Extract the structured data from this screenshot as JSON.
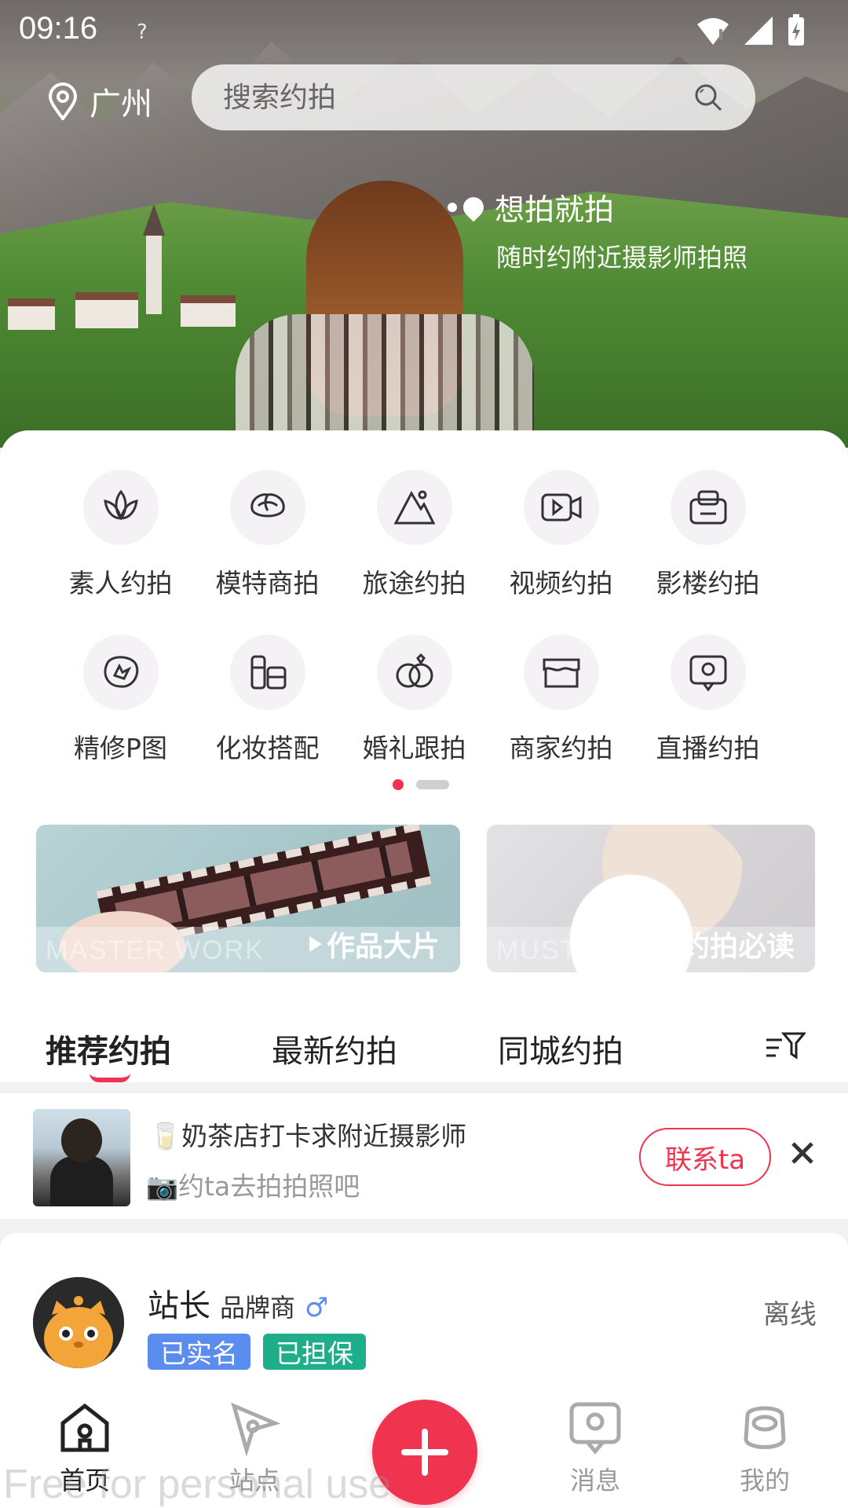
{
  "status_bar": {
    "time": "09:16",
    "unknown_glyph": "?"
  },
  "header": {
    "location": "广州",
    "search_placeholder": "搜索约拍",
    "slogan_title": "想拍就拍",
    "slogan_subtitle": "随时约附近摄影师拍照"
  },
  "categories": [
    {
      "label": "素人约拍",
      "icon": "lotus-icon"
    },
    {
      "label": "模特商拍",
      "icon": "cabbage-icon"
    },
    {
      "label": "旅途约拍",
      "icon": "mountain-icon"
    },
    {
      "label": "视频约拍",
      "icon": "video-icon"
    },
    {
      "label": "影楼约拍",
      "icon": "studio-icon"
    },
    {
      "label": "精修P图",
      "icon": "retouch-icon"
    },
    {
      "label": "化妆搭配",
      "icon": "makeup-icon"
    },
    {
      "label": "婚礼跟拍",
      "icon": "rings-icon"
    },
    {
      "label": "商家约拍",
      "icon": "shop-icon"
    },
    {
      "label": "直播约拍",
      "icon": "live-icon"
    }
  ],
  "promos": [
    {
      "ghost": "MASTER WORK",
      "title": "作品大片"
    },
    {
      "ghost": "MUST READ",
      "title": "约拍必读"
    }
  ],
  "tabs": [
    "推荐约拍",
    "最新约拍",
    "同城约拍"
  ],
  "request": {
    "line1": "🥛奶茶店打卡求附近摄影师",
    "line2": "📷约ta去拍拍照吧",
    "contact_label": "联系ta"
  },
  "user": {
    "name": "站长",
    "role": "品牌商",
    "gender_symbol": "♂",
    "status": "离线",
    "badges": [
      "已实名",
      "已担保"
    ]
  },
  "bottom_nav": [
    {
      "label": "首页",
      "icon": "home-icon",
      "active": true
    },
    {
      "label": "站点",
      "icon": "site-icon",
      "active": false
    },
    {
      "label": "消息",
      "icon": "message-icon",
      "active": false
    },
    {
      "label": "我的",
      "icon": "profile-icon",
      "active": false
    }
  ],
  "watermark": "Free for personal use",
  "colors": {
    "accent": "#f0334e",
    "badge_blue": "#5b8dee",
    "badge_green": "#1fae8a"
  }
}
